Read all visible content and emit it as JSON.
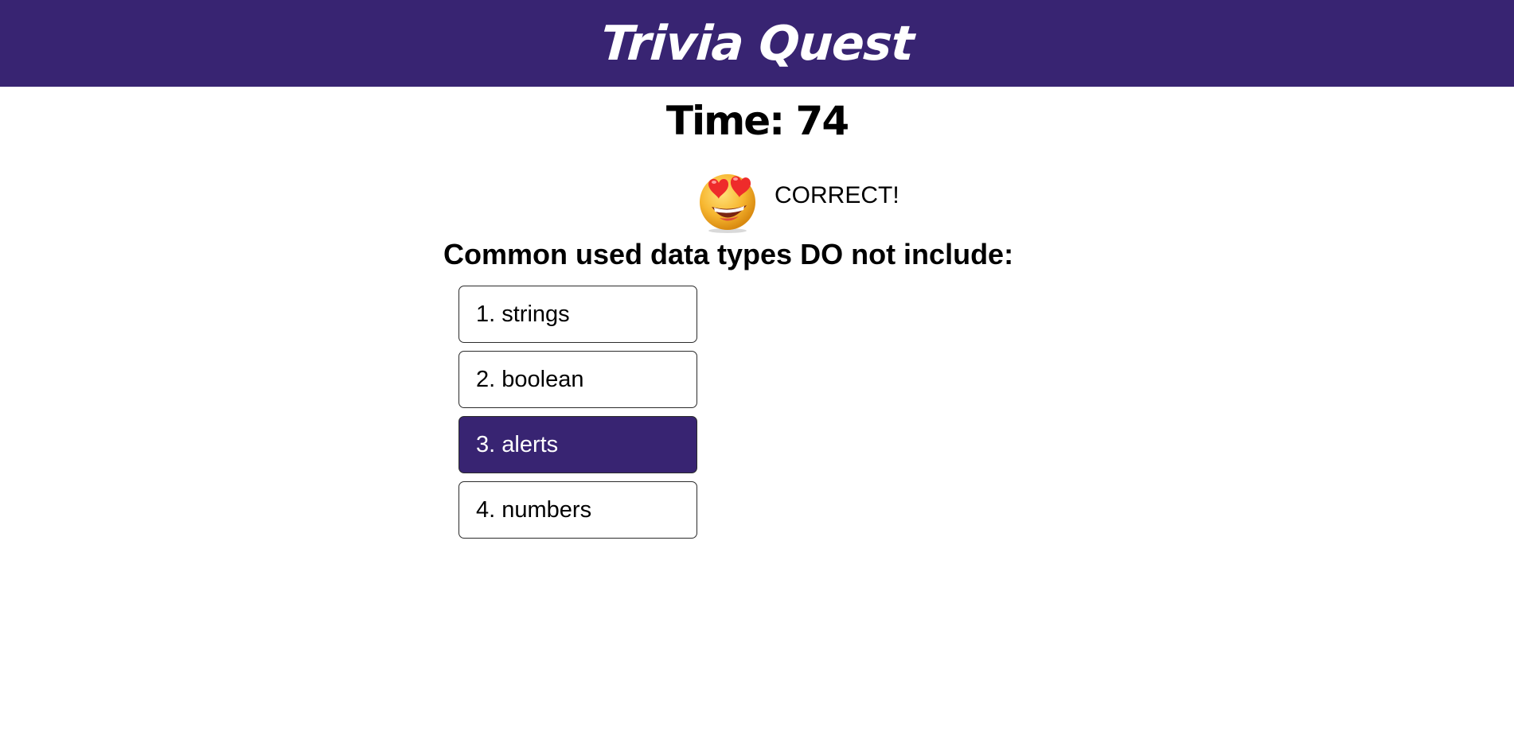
{
  "header": {
    "title": "Trivia Quest"
  },
  "timer": {
    "label": "Time: 74"
  },
  "feedback": {
    "icon": "heart-eyes-emoji-icon",
    "text": "CORRECT!"
  },
  "question": {
    "text": "Common used data types DO not include:"
  },
  "answers": [
    {
      "label": "1. strings",
      "selected": false
    },
    {
      "label": "2. boolean",
      "selected": false
    },
    {
      "label": "3. alerts",
      "selected": true
    },
    {
      "label": "4. numbers",
      "selected": false
    }
  ],
  "colors": {
    "accent": "#382472",
    "background": "#ffffff"
  }
}
